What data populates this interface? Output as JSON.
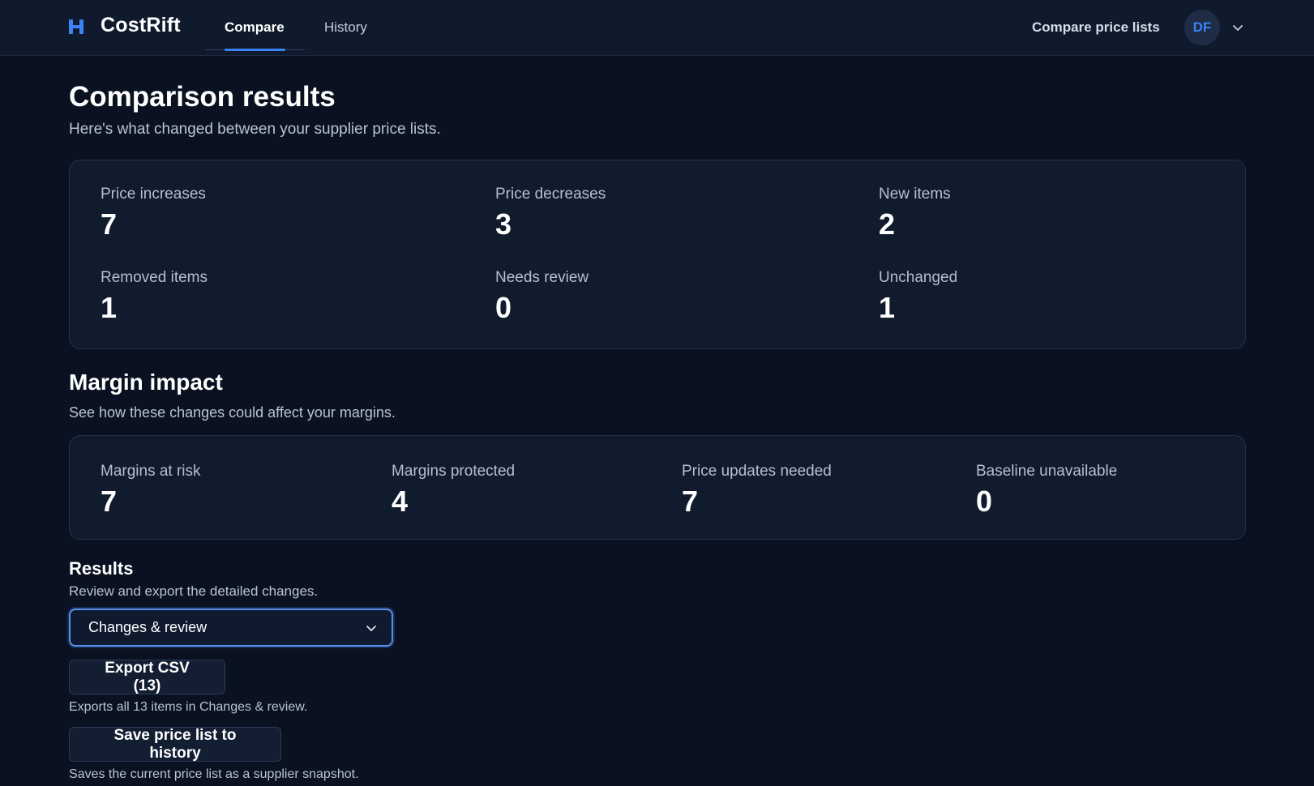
{
  "brand": {
    "name": "CostRift",
    "icon": "brand-logo-icon",
    "accent": "#3b82f6"
  },
  "nav": {
    "tabs": [
      {
        "label": "Compare",
        "active": true
      },
      {
        "label": "History",
        "active": false
      }
    ],
    "top_link": "Compare price lists",
    "avatar_initials": "DF",
    "menu_icon": "chevron-down-icon"
  },
  "page": {
    "title": "Comparison results",
    "subtitle": "Here's what changed between your supplier price lists."
  },
  "summary": {
    "stats": [
      {
        "label": "Price increases",
        "value": "7"
      },
      {
        "label": "Price decreases",
        "value": "3"
      },
      {
        "label": "New items",
        "value": "2"
      },
      {
        "label": "Removed items",
        "value": "1"
      },
      {
        "label": "Needs review",
        "value": "0"
      },
      {
        "label": "Unchanged",
        "value": "1"
      }
    ]
  },
  "margin": {
    "title": "Margin impact",
    "subtitle": "See how these changes could affect your margins.",
    "stats": [
      {
        "label": "Margins at risk",
        "value": "7"
      },
      {
        "label": "Margins protected",
        "value": "4"
      },
      {
        "label": "Price updates needed",
        "value": "7"
      },
      {
        "label": "Baseline unavailable",
        "value": "0"
      }
    ]
  },
  "results": {
    "title": "Results",
    "subtitle": "Review and export the detailed changes.",
    "view_select": {
      "selected": "Changes & review"
    },
    "export_button": "Export CSV (13)",
    "export_hint": "Exports all 13 items in Changes & review.",
    "save_button": "Save price list to history",
    "save_hint": "Saves the current price list as a supplier snapshot."
  }
}
